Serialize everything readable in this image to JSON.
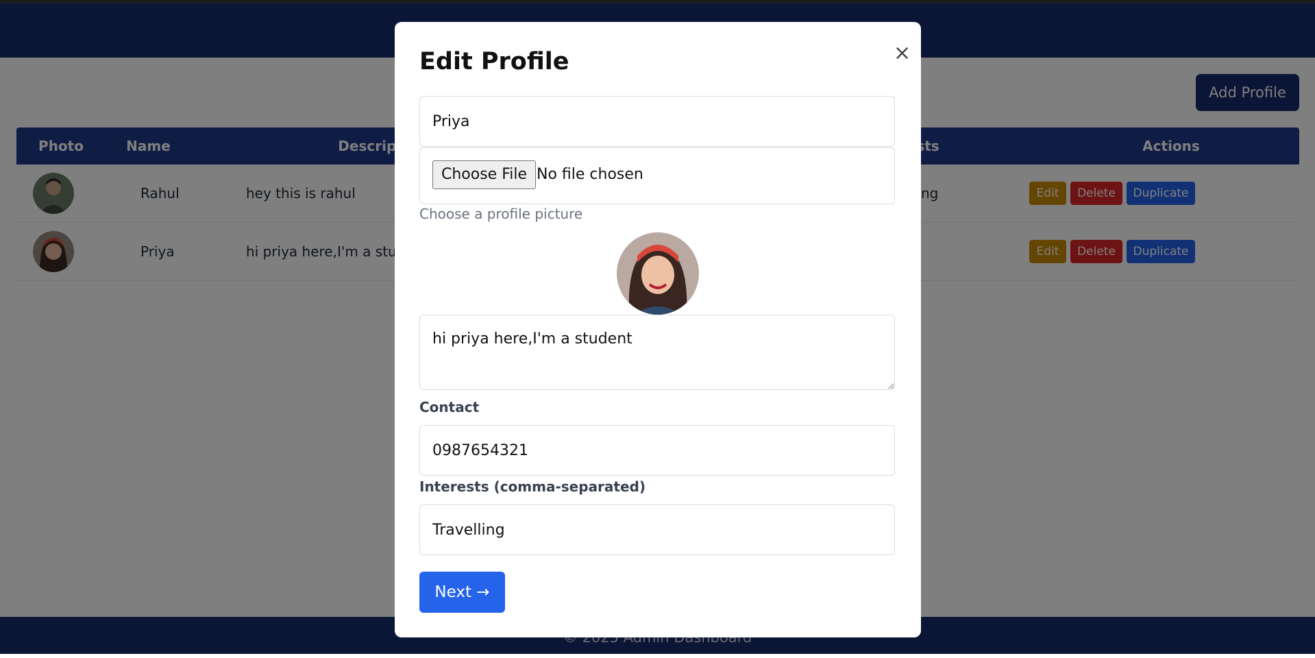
{
  "header": {},
  "add_profile_label": "Add Profile",
  "table": {
    "columns": [
      "Photo",
      "Name",
      "Descripti",
      "sts",
      "Actions"
    ],
    "rows": [
      {
        "name": "Rahul",
        "description": "hey this is rahul",
        "interests": "ng"
      },
      {
        "name": "Priya",
        "description": "hi priya here,I'm a stude",
        "interests": ""
      }
    ],
    "actions": {
      "edit": "Edit",
      "delete": "Delete",
      "duplicate": "Duplicate"
    }
  },
  "footer": {
    "text": "© 2025 Admin Dashboard"
  },
  "modal": {
    "title": "Edit Profile",
    "close": "×",
    "name_value": "Priya",
    "file_button": "Choose File",
    "file_status": "No file chosen",
    "file_hint": "Choose a profile picture",
    "description_value": "hi priya here,I'm a student",
    "contact_label": "Contact",
    "contact_value": "0987654321",
    "interests_label": "Interests (comma-separated)",
    "interests_value": "Travelling",
    "next_label": "Next →"
  },
  "colors": {
    "header": "#172a6b",
    "table_header": "#1e3a8a",
    "edit": "#ca8a04",
    "delete": "#dc2626",
    "duplicate": "#2563eb",
    "next": "#2563eb"
  }
}
